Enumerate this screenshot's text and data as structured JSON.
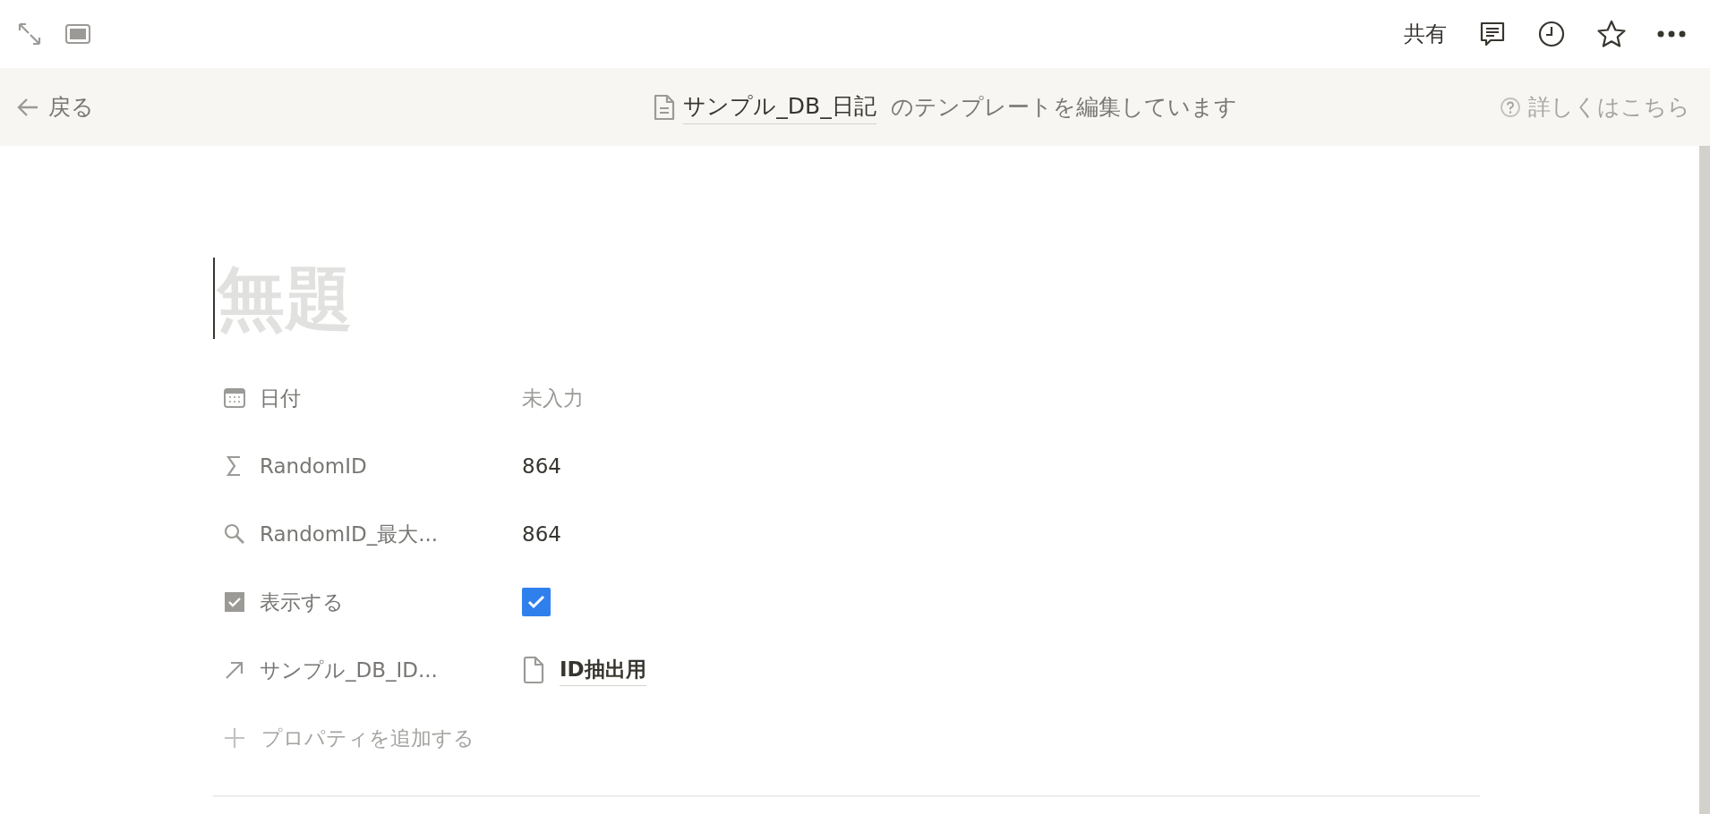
{
  "topbar": {
    "share": "共有"
  },
  "banner": {
    "back": "戻る",
    "db_name": "サンプル_DB_日記",
    "message": "のテンプレートを編集しています",
    "help": "詳しくはこちら"
  },
  "page": {
    "title_placeholder": "無題"
  },
  "properties": [
    {
      "kind": "date",
      "name": "日付",
      "value": {
        "kind": "empty",
        "text": "未入力"
      }
    },
    {
      "kind": "formula",
      "name": "RandomID",
      "value": {
        "kind": "text",
        "text": "864"
      }
    },
    {
      "kind": "rollup",
      "name": "RandomID_最大...",
      "value": {
        "kind": "text",
        "text": "864"
      }
    },
    {
      "kind": "checkbox",
      "name": "表示する",
      "value": {
        "kind": "checkbox",
        "checked": true
      }
    },
    {
      "kind": "relation",
      "name": "サンプル_DB_ID...",
      "value": {
        "kind": "page",
        "text": "ID抽出用"
      }
    }
  ],
  "add_property": "プロパティを追加する"
}
